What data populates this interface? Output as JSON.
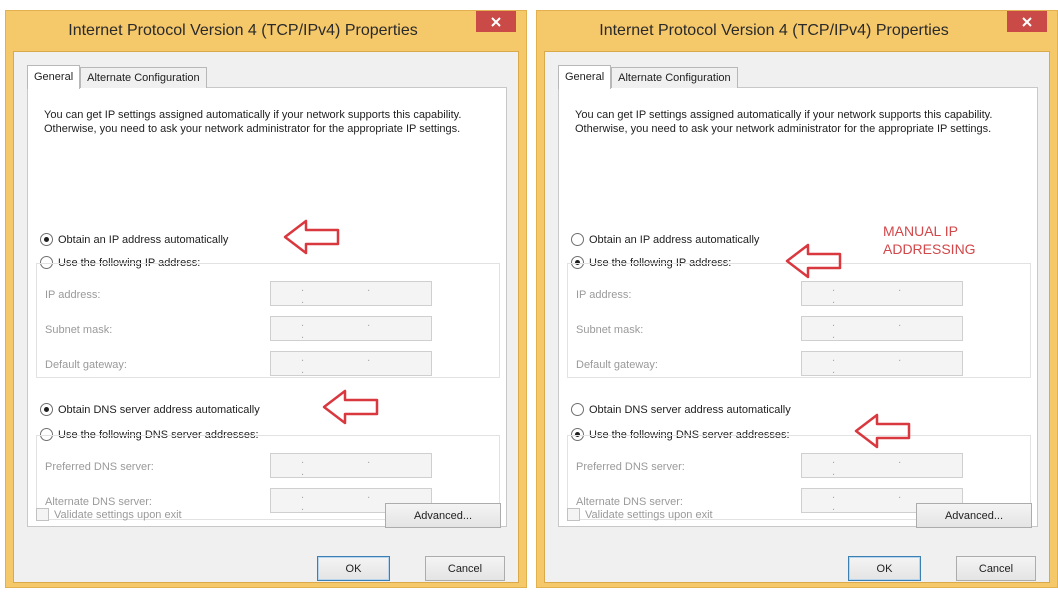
{
  "colors": {
    "arrow": "#d9383f",
    "annotation_text": "#d2474a",
    "title_bar": "#f5c86a",
    "close_button": "#c94a46"
  },
  "dialogs": [
    {
      "title": "Internet Protocol Version 4 (TCP/IPv4) Properties",
      "close_icon": "close-icon",
      "tabs": [
        "General",
        "Alternate Configuration"
      ],
      "intro": "You can get IP settings assigned automatically if your network supports this capability. Otherwise, you need to ask your network administrator for the appropriate IP settings.",
      "ip_auto_label": "Obtain an IP address automatically",
      "ip_manual_label": "Use the following IP address:",
      "ip_selection": "auto",
      "ip_fields": [
        "IP address:",
        "Subnet mask:",
        "Default gateway:"
      ],
      "dns_auto_label": "Obtain DNS server address automatically",
      "dns_manual_label": "Use the following DNS server addresses:",
      "dns_selection": "auto",
      "dns_fields": [
        "Preferred DNS server:",
        "Alternate DNS server:"
      ],
      "ip_placeholder": ". . .",
      "validate_label": "Validate settings upon exit",
      "advanced_label": "Advanced...",
      "ok_label": "OK",
      "cancel_label": "Cancel"
    },
    {
      "title": "Internet Protocol Version 4 (TCP/IPv4) Properties",
      "close_icon": "close-icon",
      "tabs": [
        "General",
        "Alternate Configuration"
      ],
      "intro": "You can get IP settings assigned automatically if your network supports this capability. Otherwise, you need to ask your network administrator for the appropriate IP settings.",
      "ip_auto_label": "Obtain an IP address automatically",
      "ip_manual_label": "Use the following IP address:",
      "ip_selection": "manual",
      "ip_fields": [
        "IP address:",
        "Subnet mask:",
        "Default gateway:"
      ],
      "dns_auto_label": "Obtain DNS server address automatically",
      "dns_manual_label": "Use the following DNS server addresses:",
      "dns_selection": "manual",
      "dns_fields": [
        "Preferred DNS server:",
        "Alternate DNS server:"
      ],
      "ip_placeholder": ". . .",
      "validate_label": "Validate settings upon exit",
      "advanced_label": "Advanced...",
      "ok_label": "OK",
      "cancel_label": "Cancel",
      "annotation": "MANUAL IP\nADDRESSING"
    }
  ]
}
